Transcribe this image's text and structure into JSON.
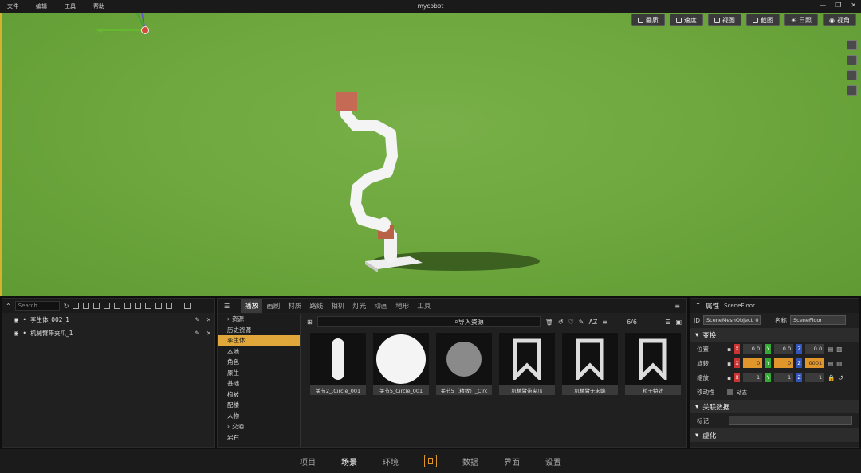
{
  "menu": [
    "文件",
    "编辑",
    "工具",
    "帮助"
  ],
  "window_title": "mycobot",
  "viewport_buttons": [
    {
      "label": "画质",
      "icon": "monitor-icon"
    },
    {
      "label": "速度",
      "icon": "speed-icon"
    },
    {
      "label": "视图",
      "icon": "view-icon"
    },
    {
      "label": "截图",
      "icon": "camera-icon"
    },
    {
      "label": "日照",
      "icon": "sun-icon"
    },
    {
      "label": "视角",
      "icon": "eye-icon"
    }
  ],
  "outliner": {
    "search_placeholder": "Search",
    "items": [
      {
        "label": "孪生体_002_1"
      },
      {
        "label": "机械臂带夹爪_1"
      }
    ]
  },
  "content": {
    "tabs": [
      "播放",
      "画刷",
      "材质",
      "路线",
      "相机",
      "灯光",
      "动画",
      "地形",
      "工具"
    ],
    "tree": [
      "资源",
      "历史资源",
      "孪生体",
      "本地",
      "角色",
      "原生",
      "基础",
      "植被",
      "配楼",
      "人物",
      "交通",
      "岩石"
    ],
    "selected_tree": "孪生体",
    "import_label": "导入资源",
    "count": "6/6",
    "assets": [
      "关节2_.Circle_001",
      "关节5_Circle_001",
      "关节5（精致）_Circ",
      "机械臂带夹爪",
      "机械臂无末端",
      "粒子特效"
    ]
  },
  "props": {
    "title": "属性",
    "object": "SceneFloor",
    "id_label": "ID",
    "id_value": "SceneMeshObject_0",
    "name_label": "名称",
    "name_value": "SceneFloor",
    "transform_section": "变换",
    "position_label": "位置",
    "position": [
      "0.0",
      "0.0",
      "0.0"
    ],
    "rotation_label": "旋转",
    "rotation": [
      "0",
      "0",
      "0001"
    ],
    "scale_label": "缩放",
    "scale": [
      "1",
      "1",
      "1"
    ],
    "mobility_label": "移动性",
    "mobility_value": "动态",
    "link_section": "关联数据",
    "tag_label": "标记",
    "virtual_section": "虚化"
  },
  "footer_tabs": [
    "项目",
    "场景",
    "环境",
    "数据",
    "界面",
    "设置"
  ],
  "active_footer": "场景",
  "colors": {
    "accent": "#e0962a",
    "grass": "#6ea83e"
  }
}
